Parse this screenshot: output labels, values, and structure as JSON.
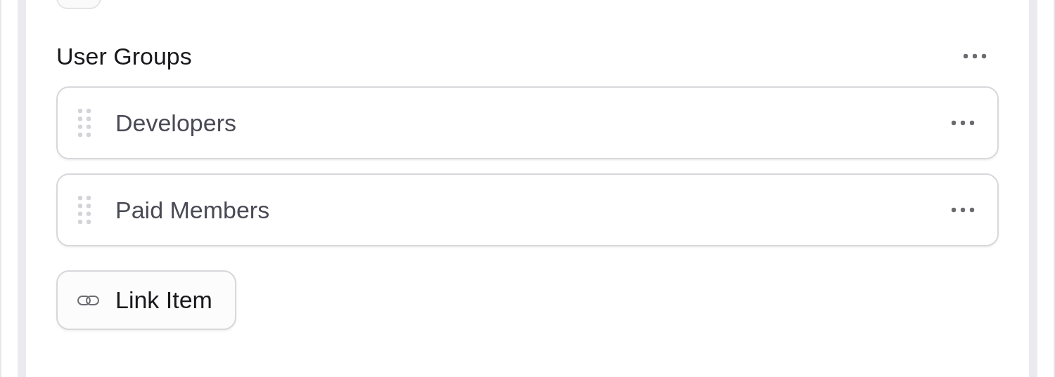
{
  "section": {
    "title": "User Groups"
  },
  "items": [
    {
      "label": "Developers"
    },
    {
      "label": "Paid Members"
    }
  ],
  "link_button": {
    "label": "Link Item"
  }
}
